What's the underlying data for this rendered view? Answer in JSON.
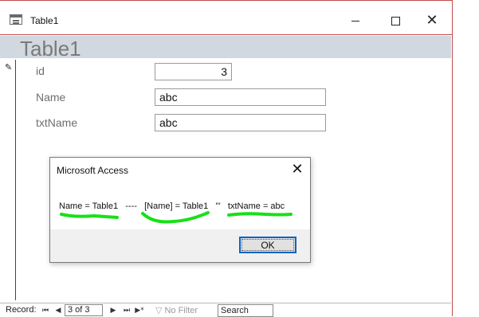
{
  "window": {
    "title": "Table1",
    "close_glyph": "✕"
  },
  "form": {
    "title": "Table1",
    "record_icon": "pencil-icon",
    "fields": [
      {
        "label": "id",
        "value": "3"
      },
      {
        "label": "Name",
        "value": "abc"
      },
      {
        "label": "txtName",
        "value": "abc"
      }
    ]
  },
  "dialog": {
    "title": "Microsoft Access",
    "close_glyph": "✕",
    "message": "Name = Table1   ----   [Name] = Table1   '''   txtName = abc",
    "ok_label": "OK",
    "highlight_color": "#18e018"
  },
  "nav": {
    "record_label": "Record:",
    "first_glyph": "⏮",
    "prev_glyph": "◀",
    "current": "3 of 3",
    "next_glyph": "▶",
    "last_glyph": "⏭",
    "new_glyph": "▶*",
    "filter_label": "No Filter",
    "search_label": "Search"
  }
}
